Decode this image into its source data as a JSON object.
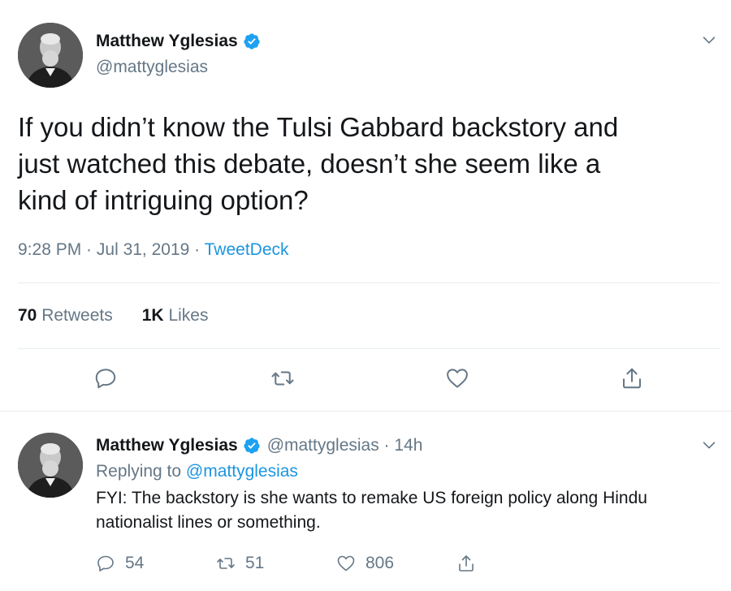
{
  "colors": {
    "text": "#14171a",
    "secondary": "#657786",
    "link": "#1b95e0",
    "verified": "#1da1f2",
    "divider": "#e6ecf0"
  },
  "main_tweet": {
    "name": "Matthew Yglesias",
    "handle": "@mattyglesias",
    "text": "If you didn’t know the Tulsi Gabbard backstory and\njust watched this debate, doesn’t she seem like a\nkind of intriguing option?",
    "time": "9:28 PM",
    "date": "Jul 31, 2019",
    "separator": " · ",
    "source": "TweetDeck",
    "retweets_count": "70",
    "retweets_label": "Retweets",
    "likes_count": "1K",
    "likes_label": "Likes",
    "actions": [
      "reply-icon",
      "retweet-icon",
      "like-icon",
      "share-icon"
    ]
  },
  "reply_tweet": {
    "name": "Matthew Yglesias",
    "handle_time": "@mattyglesias · 14h",
    "replying_prefix": "Replying to ",
    "replying_to": "@mattyglesias",
    "text": "FYI: The backstory is she wants to remake US foreign policy along Hindu nationalist lines or something.",
    "reply_count": "54",
    "retweet_count": "51",
    "like_count": "806"
  }
}
